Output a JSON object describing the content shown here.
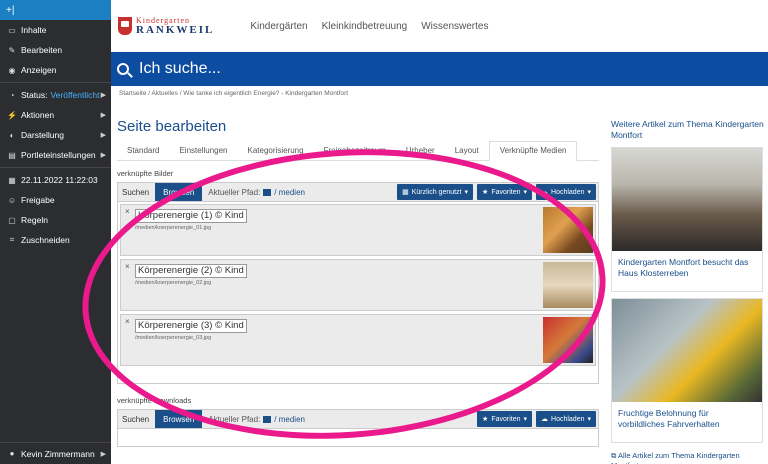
{
  "toolbar": {
    "items": [
      {
        "label": "Inhalte"
      },
      {
        "label": "Bearbeiten"
      },
      {
        "label": "Anzeigen"
      },
      {
        "label": "Status:",
        "value": "Veröffentlicht"
      },
      {
        "label": "Aktionen"
      },
      {
        "label": "Darstellung"
      },
      {
        "label": "Portleteinstellungen"
      },
      {
        "label": "22.11.2022 11:22:03"
      },
      {
        "label": "Freigabe"
      },
      {
        "label": "Regeln"
      },
      {
        "label": "Zuschneiden"
      }
    ],
    "user": "Kevin Zimmermann"
  },
  "logo": {
    "line1": "Kindergarten",
    "line2": "RANKWEIL"
  },
  "nav": [
    "Kindergärten",
    "Kleinkindbetreuung",
    "Wissenswertes"
  ],
  "search": {
    "placeholder": "Ich suche..."
  },
  "breadcrumb": "Startseite / Aktuelles / Wie tanke ich eigentlich Energie? - Kindergarten Montfort",
  "main": {
    "title": "Seite bearbeiten",
    "tabs": [
      "Standard",
      "Einstellungen",
      "Kategorisierung",
      "Freigabezeitraum",
      "Urheber",
      "Layout",
      "Verknüpfte Medien"
    ],
    "images_label": "verknüpfte Bilder",
    "downloads_label": "verknüpfte Downloads",
    "picker": {
      "search": "Suchen",
      "browse": "Browsen",
      "path_label": "Aktueller Pfad:",
      "path_value": "/ medien",
      "recent": "Kürzlich genutzt",
      "favorites": "Favoriten",
      "upload": "Hochladen"
    },
    "images": [
      {
        "title": "Körperenergie (1) © Kind",
        "path": "/medien/koerperenergie_01.jpg"
      },
      {
        "title": "Körperenergie (2) © Kind",
        "path": "/medien/koerperenergie_02.jpg"
      },
      {
        "title": "Körperenergie (3) © Kind",
        "path": "/medien/koerperenergie_03.jpg"
      }
    ]
  },
  "aside": {
    "heading": "Weitere Artikel zum Thema Kindergarten Montfort",
    "cards": [
      {
        "caption": "Kindergarten Montfort besucht das Haus Klosterreben"
      },
      {
        "caption": "Fruchtige Belohnung für vorbildliches Fahrverhalten"
      }
    ],
    "all_link": "Alle Artikel zum Thema Kindergarten Montfort"
  },
  "colors": {
    "accent": "#1a4f8a",
    "highlight": "#ea1a8c",
    "toolbar_top": "#1b7fc4"
  }
}
